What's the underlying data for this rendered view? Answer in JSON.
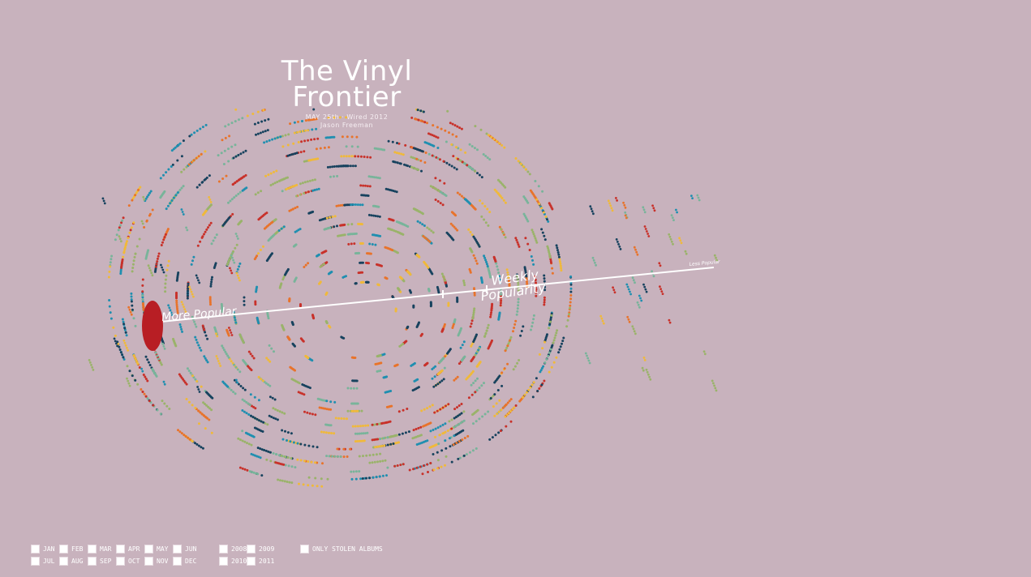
{
  "title": {
    "line1": "The Vinyl",
    "line2": "Frontier"
  },
  "subtitle": {
    "date": "MAY 25th · Wired 2012",
    "author": "Jason Freeman"
  },
  "axis": {
    "left_label": "More Popular",
    "center_label_1": "Weekly",
    "center_label_2": "Popularity",
    "right_label": "Less Popular"
  },
  "colors": {
    "background": "#c8b2bd",
    "palette": [
      "#c8312a",
      "#e8732b",
      "#f0b93a",
      "#1f8fb0",
      "#17425e",
      "#78b49a",
      "#9ab36a"
    ],
    "marker": "#b81e24",
    "axis": "#ffffff"
  },
  "filters": {
    "months": [
      "JAN",
      "FEB",
      "MAR",
      "APR",
      "MAY",
      "JUN",
      "JUL",
      "AUG",
      "SEP",
      "OCT",
      "NOV",
      "DEC"
    ],
    "years": [
      "2008",
      "2009",
      "2010",
      "2011"
    ],
    "stolen": "ONLY STOLEN ALBUMS"
  }
}
